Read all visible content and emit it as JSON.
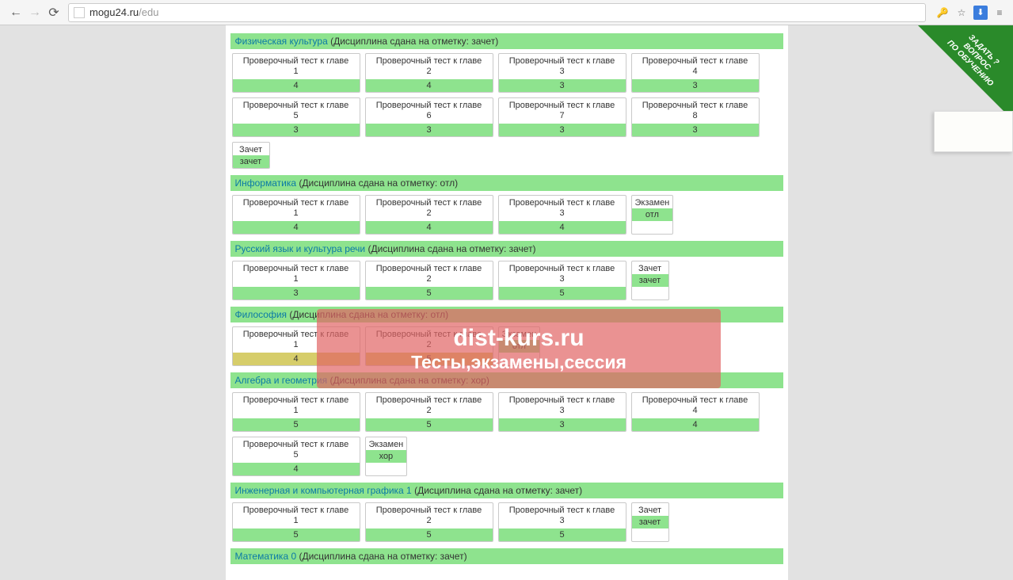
{
  "browser": {
    "url_host": "mogu24.ru",
    "url_path": "/edu"
  },
  "corner": {
    "line1": "ЗАДАТЬ",
    "line2": "ВОПРОС",
    "line3": "ПО ОБУЧЕНИЮ",
    "q": "?"
  },
  "watermark": {
    "line1": "dist-kurs.ru",
    "line2": "Тесты,экзамены,сессия"
  },
  "subjects": [
    {
      "name": "Физическая культура",
      "status": "(Дисциплина сдана на отметку: зачет)",
      "tests": [
        {
          "title": "Проверочный тест к главе",
          "num": "1",
          "score": "4"
        },
        {
          "title": "Проверочный тест к главе",
          "num": "2",
          "score": "4"
        },
        {
          "title": "Проверочный тест к главе",
          "num": "3",
          "score": "3"
        },
        {
          "title": "Проверочный тест к главе",
          "num": "4",
          "score": "3"
        },
        {
          "title": "Проверочный тест к главе",
          "num": "5",
          "score": "3"
        },
        {
          "title": "Проверочный тест к главе",
          "num": "6",
          "score": "3"
        },
        {
          "title": "Проверочный тест к главе",
          "num": "7",
          "score": "3"
        },
        {
          "title": "Проверочный тест к главе",
          "num": "8",
          "score": "3"
        },
        {
          "title": "Зачет",
          "num": "",
          "score": "зачет",
          "small": true
        }
      ]
    },
    {
      "name": "Информатика",
      "status": "(Дисциплина сдана на отметку: отл)",
      "tests": [
        {
          "title": "Проверочный тест к главе",
          "num": "1",
          "score": "4"
        },
        {
          "title": "Проверочный тест к главе",
          "num": "2",
          "score": "4"
        },
        {
          "title": "Проверочный тест к главе",
          "num": "3",
          "score": "4"
        },
        {
          "title": "Экзамен",
          "num": "",
          "score": "отл",
          "small": true
        }
      ]
    },
    {
      "name": "Русский язык и культура речи",
      "status": "(Дисциплина сдана на отметку: зачет)",
      "tests": [
        {
          "title": "Проверочный тест к главе",
          "num": "1",
          "score": "3"
        },
        {
          "title": "Проверочный тест к главе",
          "num": "2",
          "score": "5"
        },
        {
          "title": "Проверочный тест к главе",
          "num": "3",
          "score": "5"
        },
        {
          "title": "Зачет",
          "num": "",
          "score": "зачет",
          "small": true
        }
      ]
    },
    {
      "name": "Философия",
      "status": "(Дисциплина сдана на отметку: отл)",
      "tests": [
        {
          "title": "Проверочный тест к главе",
          "num": "1",
          "score": "4",
          "scoreClass": "yellow"
        },
        {
          "title": "Проверочный тест к главе",
          "num": "2",
          "score": "5",
          "scoreClass": "yellow"
        },
        {
          "title": "Экзамен",
          "num": "",
          "score": "отл",
          "small": true
        }
      ]
    },
    {
      "name": "Алгебра и геометрия",
      "status": "(Дисциплина сдана на отметку: хор)",
      "tests": [
        {
          "title": "Проверочный тест к главе",
          "num": "1",
          "score": "5"
        },
        {
          "title": "Проверочный тест к главе",
          "num": "2",
          "score": "5"
        },
        {
          "title": "Проверочный тест к главе",
          "num": "3",
          "score": "3"
        },
        {
          "title": "Проверочный тест к главе",
          "num": "4",
          "score": "4"
        },
        {
          "title": "Проверочный тест к главе",
          "num": "5",
          "score": "4"
        },
        {
          "title": "Экзамен",
          "num": "",
          "score": "хор",
          "small": true
        }
      ]
    },
    {
      "name": "Инженерная и компьютерная графика 1",
      "status": "(Дисциплина сдана на отметку: зачет)",
      "tests": [
        {
          "title": "Проверочный тест к главе",
          "num": "1",
          "score": "5"
        },
        {
          "title": "Проверочный тест к главе",
          "num": "2",
          "score": "5"
        },
        {
          "title": "Проверочный тест к главе",
          "num": "3",
          "score": "5"
        },
        {
          "title": "Зачет",
          "num": "",
          "score": "зачет",
          "small": true
        }
      ]
    },
    {
      "name": "Математика 0",
      "status": "(Дисциплина сдана на отметку: зачет)",
      "tests": []
    }
  ]
}
